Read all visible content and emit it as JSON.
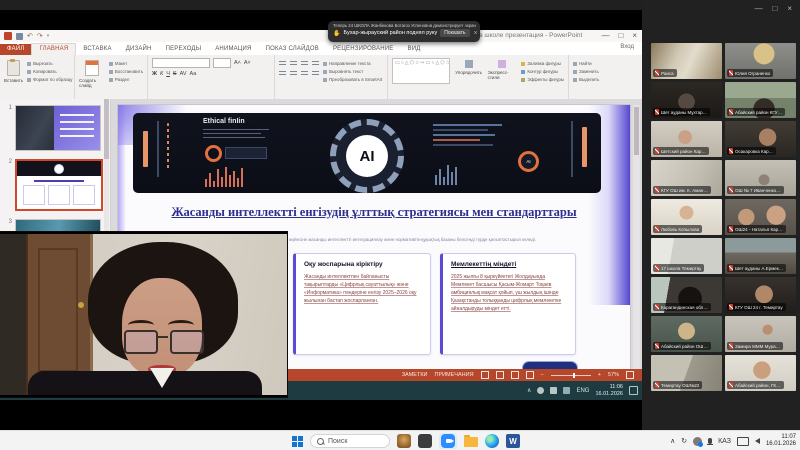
{
  "colors": {
    "ppt_red": "#b7472a",
    "zoom_blue": "#2d8cff",
    "slide_purple": "#5b4bd4",
    "banner_dark": "#10131d",
    "mic_red": "#d63c31"
  },
  "zoom_ui": {
    "toast": {
      "line1": "Теперь 24 ШКОЛА Жанбекова Ботагоз Успеновна демонстрирует экран",
      "hand_icon": "✋",
      "line2": "Бухар-жырауский район поднял руку",
      "action": "Показать",
      "close": "×"
    },
    "controls": {
      "min": "—",
      "max": "□",
      "close": "×"
    }
  },
  "ppt": {
    "title": "ИИ в школе презентация - PowerPoint",
    "signin": "Вход",
    "controls": {
      "min": "—",
      "max": "□",
      "close": "×"
    },
    "tabs": [
      "ФАЙЛ",
      "ГЛАВНАЯ",
      "ВСТАВКА",
      "ДИЗАЙН",
      "ПЕРЕХОДЫ",
      "АНИМАЦИЯ",
      "ПОКАЗ СЛАЙДОВ",
      "РЕЦЕНЗИРОВАНИЕ",
      "ВИД"
    ],
    "ribbon": {
      "clipboard": {
        "paste": "Вставить",
        "cut": "Вырезать",
        "copy": "Копировать",
        "painter": "Формат по образцу",
        "label": "Буфер обмена"
      },
      "slides": {
        "new": "Создать слайд",
        "layout": "Макет",
        "reset": "Восстановить",
        "section": "Раздел",
        "label": "Слайды"
      },
      "font": {
        "bold": "Ж",
        "italic": "К",
        "underline": "Ч",
        "strike": "S",
        "spacing": "AV",
        "case": "Аа",
        "label": "Шрифт"
      },
      "paragraph": {
        "dir": "Направление текста",
        "align_text": "Выровнять текст",
        "smartart": "Преобразовать в SmartArt",
        "label": "Абзац"
      },
      "drawing": {
        "shapes": "▭○△⬠☆⇨▭○△⬠☆⇨▭○△",
        "arrange": "Упорядочить",
        "styles": "Экспресс-стили",
        "fill": "Заливка фигуры",
        "outline": "Контур фигуры",
        "effects": "Эффекты фигуры",
        "label": "Рисование"
      },
      "editing": {
        "find": "Найти",
        "replace": "Заменить",
        "select": "Выделить",
        "label": "Редактирование"
      }
    },
    "thumbs": [
      "1",
      "2",
      "3"
    ],
    "status": {
      "notes": "ЗАМЕТКИ",
      "comments": "ПРИМЕЧАНИЯ",
      "zoom": "57%"
    }
  },
  "slide": {
    "banner": {
      "brand": "Ethical finIin",
      "ai": "AI"
    },
    "title": "Жасанды интеллектті енгізудің ұлттық стратегиясы мен стандарттары",
    "subtitle": "Қазақстан соңғы жылдары білім беру жүйесіне жасанды интеллектті интеграциялау және нормативтік-құқықтық базаны белсенді түрде қалыптастырып келеді.",
    "cards": [
      {
        "title": "Оқу жоспарына кіріктіру",
        "body": "Жасанды интеллектпен байланысты тақырыптарды «Цифрлық сауаттылық» және «Информатика» пәндеріне енгізу 2025–2026 оқу жылынан бастап жоспарланған."
      },
      {
        "title": "Мемлекеттің міндеті",
        "body": "2025 жылғы 8 қыркүйектегі Жолдауында Мемлекет басшысы Қасым-Жомарт Тоқаев амбициялық мақсат қойып, үш жылдың ішінде Қазақстанды толыққанды цифрлық мемлекетке айналдыруды міндет етті."
      }
    ]
  },
  "shared_tray": {
    "lang": "ENG",
    "time": "11:06",
    "date": "16.01.2026"
  },
  "participants": [
    {
      "name": "Раиса"
    },
    {
      "name": "Юлия Ограненко"
    },
    {
      "name": "Шет ауданы Мұхтар…"
    },
    {
      "name": "Абайский район КГУ…"
    },
    {
      "name": "Шетский район Кар…"
    },
    {
      "name": "Осакаровка Кар…"
    },
    {
      "name": "КГУ ОШ им. К. Аман…"
    },
    {
      "name": "ОШ № 7 Иванченко…"
    },
    {
      "name": "Любовь Копылова"
    },
    {
      "name": "ОШ24 - Наталья Кар…"
    },
    {
      "name": "17 школа Темиртау"
    },
    {
      "name": "Шет ауданы А.Ермек…"
    },
    {
      "name": "Карагандинская обл…"
    },
    {
      "name": "КГУ ОШ 24 г. Темиртау"
    },
    {
      "name": "Абайский район ОШ…"
    },
    {
      "name": "Замира МММ Мура…"
    },
    {
      "name": "Темиртау ОШ№22"
    },
    {
      "name": "Абайский район, ГК…"
    }
  ],
  "taskbar": {
    "search": "Поиск",
    "lang": "КАЗ",
    "time": "11:07",
    "date": "16.01.2026"
  }
}
